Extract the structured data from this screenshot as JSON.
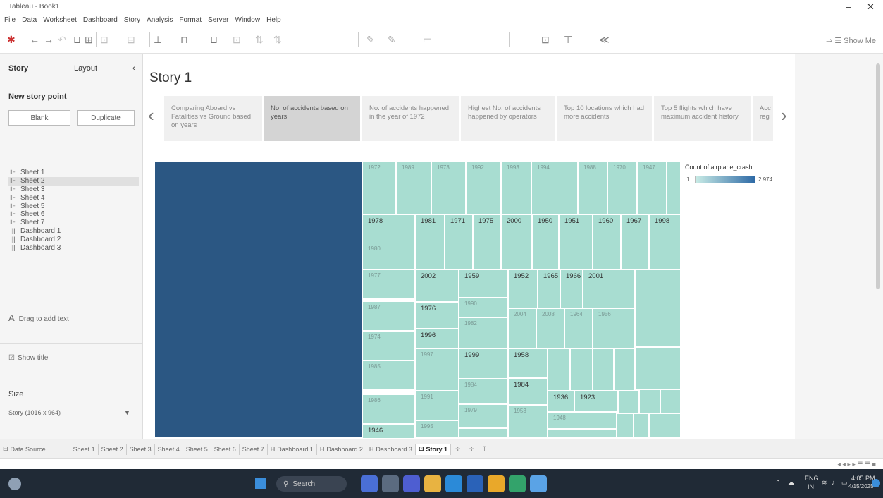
{
  "window": {
    "title": "Tableau - Book1",
    "minimize": "–",
    "close": "✕"
  },
  "menu": [
    "File",
    "Data",
    "Worksheet",
    "Dashboard",
    "Story",
    "Analysis",
    "Format",
    "Server",
    "Window",
    "Help"
  ],
  "toolbar": {
    "show_me": "Show Me"
  },
  "left_panel": {
    "tab_story": "Story",
    "tab_layout": "Layout",
    "collapse": "‹",
    "new_story_point": "New story point",
    "blank": "Blank",
    "duplicate": "Duplicate",
    "sheets": [
      {
        "icon": "sheet",
        "label": "Sheet 1"
      },
      {
        "icon": "sheet",
        "label": "Sheet 2"
      },
      {
        "icon": "sheet",
        "label": "Sheet 3"
      },
      {
        "icon": "sheet",
        "label": "Sheet 4"
      },
      {
        "icon": "sheet",
        "label": "Sheet 5"
      },
      {
        "icon": "sheet",
        "label": "Sheet 6"
      },
      {
        "icon": "sheet",
        "label": "Sheet 7"
      },
      {
        "icon": "dashboard",
        "label": "Dashboard 1"
      },
      {
        "icon": "dashboard",
        "label": "Dashboard 2"
      },
      {
        "icon": "dashboard",
        "label": "Dashboard 3"
      }
    ],
    "drag_text": "Drag to add text",
    "show_title": "Show title",
    "size_label": "Size",
    "size_value": "Story (1016 x 964)"
  },
  "story": {
    "title": "Story 1",
    "points": [
      "Comparing Aboard vs Fatalities vs Ground based on years",
      "No. of accidents based on years",
      "No. of accidents happened in the year of 1972",
      "Highest No. of accidents happened by operators",
      "Top 10 locations which had more accidents",
      "Top 5 flights which have maximum accident history",
      "Acc reg"
    ],
    "active_index": 1
  },
  "chart_data": {
    "type": "treemap",
    "measure": "Count of airplane_crash",
    "color_range": [
      1,
      2974
    ],
    "color_min_hex": "#c9ece6",
    "color_max_hex": "#2e6aa6",
    "labels": [
      "1972",
      "1989",
      "1973",
      "1992",
      "1993",
      "1994",
      "1988",
      "1970",
      "1947",
      "1978",
      "1981",
      "1971",
      "1975",
      "2000",
      "1950",
      "1951",
      "1960",
      "1967",
      "1998",
      "1980",
      "1977",
      "1987",
      "1974",
      "1985",
      "1986",
      "1946",
      "2002",
      "1976",
      "1996",
      "1997",
      "1991",
      "1995",
      "1959",
      "1990",
      "1982",
      "1999",
      "1984",
      "1979",
      "1983",
      "1952",
      "1965",
      "1966",
      "2001",
      "2004",
      "2008",
      "1964",
      "1956",
      "1958",
      "1953",
      "1984",
      "1936",
      "1923",
      "1948"
    ]
  },
  "tabs": [
    {
      "icon": "datasource",
      "label": "Data Source"
    },
    {
      "icon": "",
      "label": "Sheet 1"
    },
    {
      "icon": "",
      "label": "Sheet 2"
    },
    {
      "icon": "",
      "label": "Sheet 3"
    },
    {
      "icon": "",
      "label": "Sheet 4"
    },
    {
      "icon": "",
      "label": "Sheet 5"
    },
    {
      "icon": "",
      "label": "Sheet 6"
    },
    {
      "icon": "",
      "label": "Sheet 7"
    },
    {
      "icon": "dashboard",
      "label": "Dashboard 1"
    },
    {
      "icon": "dashboard",
      "label": "Dashboard 2"
    },
    {
      "icon": "dashboard",
      "label": "Dashboard 3"
    },
    {
      "icon": "story",
      "label": "Story 1"
    }
  ],
  "taskbar": {
    "search": "Search",
    "lang_top": "ENG",
    "lang_bottom": "IN",
    "time": "4:05 PM",
    "date": "4/15/2025"
  }
}
